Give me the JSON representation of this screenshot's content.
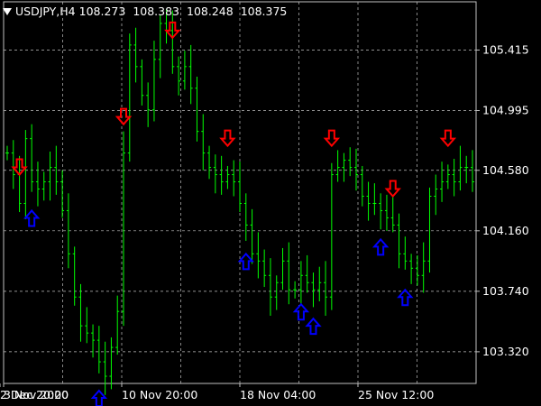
{
  "header": {
    "symbol_tf": "USDJPY,H4",
    "open": "108.273",
    "high": "108.383",
    "low": "108.248",
    "close": "108.375"
  },
  "colors": {
    "background": "#000000",
    "candle": "#00ff00",
    "grid": "#c0c0c0",
    "sell_arrow": "#ff0000",
    "buy_arrow": "#0000ff",
    "axis_text": "#ffffff"
  },
  "chart_data": {
    "type": "line",
    "style": "bars",
    "grid": true,
    "ylim": [
      103.1,
      105.75
    ],
    "yticks": [
      "105.415",
      "104.995",
      "104.580",
      "104.160",
      "103.740",
      "103.320"
    ],
    "xticks": [
      "3 Nov 2020",
      "10 Nov 20:00",
      "18 Nov 04:00",
      "25 Nov 12:00",
      "2 Dec 20:00"
    ],
    "close_series": [
      104.7,
      104.55,
      104.35,
      104.8,
      104.5,
      104.45,
      104.5,
      104.6,
      104.5,
      104.3,
      104.0,
      103.7,
      103.5,
      103.45,
      103.4,
      103.25,
      103.15,
      103.35,
      103.6,
      104.7,
      105.45,
      105.3,
      105.1,
      105.0,
      105.35,
      105.6,
      105.55,
      105.3,
      105.2,
      105.3,
      105.15,
      104.85,
      104.7,
      104.6,
      104.55,
      104.5,
      104.55,
      104.5,
      104.35,
      104.2,
      104.0,
      103.95,
      103.85,
      103.7,
      103.8,
      103.95,
      103.75,
      103.75,
      103.85,
      103.8,
      103.75,
      103.8,
      103.7,
      104.55,
      104.6,
      104.65,
      104.6,
      104.55,
      104.4,
      104.35,
      104.35,
      104.3,
      104.25,
      104.2,
      104.0,
      103.95,
      103.9,
      103.85,
      103.95,
      104.4,
      104.45,
      104.5,
      104.55,
      104.5,
      104.6,
      104.6,
      104.5
    ],
    "sell_signal_indices": [
      2,
      19,
      27,
      36,
      53,
      63,
      72
    ],
    "buy_signal_indices": [
      4,
      15,
      39,
      48,
      50,
      61,
      65
    ]
  }
}
